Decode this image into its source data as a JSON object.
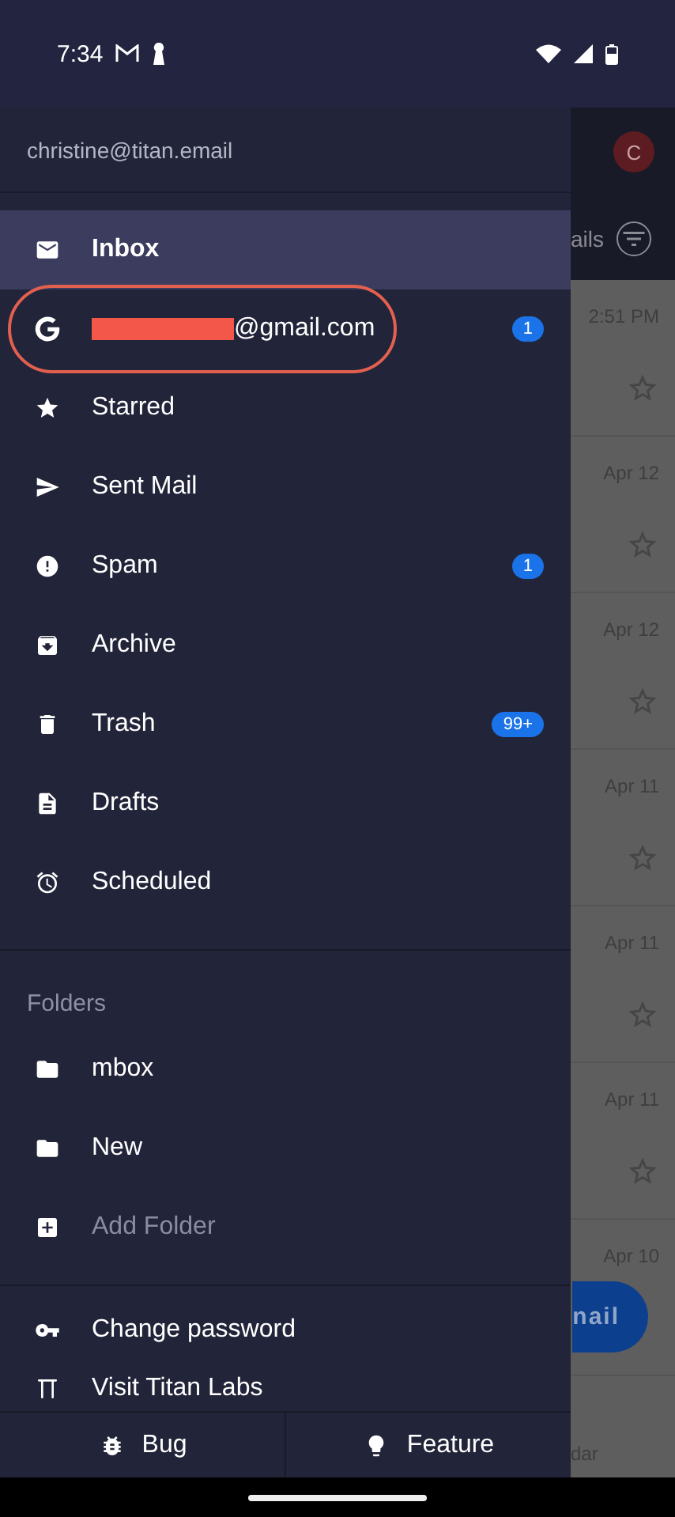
{
  "status_bar": {
    "time": "7:34"
  },
  "drawer": {
    "account": "christine@titan.email",
    "mailboxes": [
      {
        "label": "Inbox",
        "selected": true
      },
      {
        "label": "@gmail.com",
        "selected": false,
        "redacted": true,
        "badge": "1",
        "circled": true
      },
      {
        "label": "Starred",
        "selected": false
      },
      {
        "label": "Sent Mail",
        "selected": false
      },
      {
        "label": "Spam",
        "selected": false,
        "badge": "1"
      },
      {
        "label": "Archive",
        "selected": false
      },
      {
        "label": "Trash",
        "selected": false,
        "badge": "99+"
      },
      {
        "label": "Drafts",
        "selected": false
      },
      {
        "label": "Scheduled",
        "selected": false
      }
    ],
    "folders_heading": "Folders",
    "folders": [
      {
        "label": "mbox",
        "disabled": false
      },
      {
        "label": "New",
        "disabled": false
      },
      {
        "label": "Add Folder",
        "disabled": true
      }
    ],
    "links": [
      "Change password",
      "Visit Titan Labs"
    ],
    "footer_buttons": [
      "Bug",
      "Feature"
    ]
  },
  "background_app": {
    "avatar_letter": "C",
    "tab_fragment": "ails",
    "rows": [
      {
        "time": "2:51 PM"
      },
      {
        "time": "Apr 12"
      },
      {
        "time": "Apr 12"
      },
      {
        "time": "Apr 11"
      },
      {
        "time": "Apr 11"
      },
      {
        "time": "Apr 11"
      },
      {
        "time": "Apr 10"
      }
    ],
    "fab_fragment": "nail",
    "nav_fragment": "dar"
  }
}
